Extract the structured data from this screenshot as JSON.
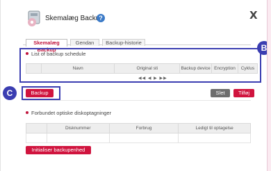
{
  "window": {
    "title": "Skemalæg Backup",
    "help_symbol": "?",
    "close_symbol": "X"
  },
  "tabs": [
    {
      "label": "Skemalæg Backup",
      "active": true
    },
    {
      "label": "Gendan",
      "active": false
    },
    {
      "label": "Backup-historie",
      "active": false
    }
  ],
  "backup_schedule": {
    "heading": "List of backup schedule",
    "columns": [
      "",
      "Navn",
      "Original sti",
      "Backup device",
      "Encryption",
      "Cyklus"
    ],
    "pager": "◀◀ ◀ ▶ ▶▶"
  },
  "actions": {
    "backup_label": "Backup",
    "delete_label": "Slet",
    "add_label": "Tilføj"
  },
  "storage": {
    "heading": "Forbundet optiske diskoptagninger",
    "columns": [
      "",
      "Disknummer",
      "Forbrug",
      "Ledigt til optagelse"
    ],
    "init_label": "Initialiser backupenhed"
  },
  "callouts": {
    "b": "B",
    "c": "C"
  },
  "colors": {
    "accent": "#d0143e",
    "callout": "#3a3db1",
    "neutral_button": "#6d6d6d"
  },
  "icons": {
    "app": "backup-app-icon",
    "help": "help-icon",
    "close": "close-icon"
  }
}
